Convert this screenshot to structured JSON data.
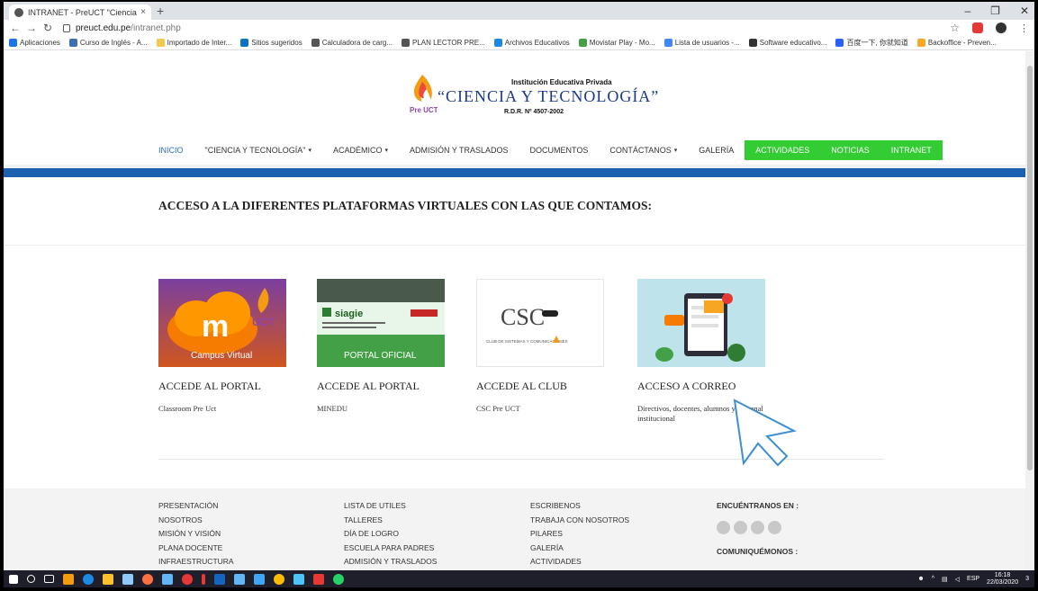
{
  "browser": {
    "tab_title": "INTRANET - PreUCT \"Ciencia y T",
    "tab_close": "×",
    "newtab": "+",
    "url_host": "preuct.edu.pe",
    "url_path": "/intranet.php",
    "bookmarks": [
      {
        "label": "Aplicaciones",
        "color": "#1a73e8"
      },
      {
        "label": "Curso de Inglés - A...",
        "color": "#3e6fb5"
      },
      {
        "label": "Importado de Inter...",
        "color": "#f2c94c"
      },
      {
        "label": "Sitios sugeridos",
        "color": "#0b73c2"
      },
      {
        "label": "Calculadora de carg...",
        "color": "#555555"
      },
      {
        "label": "PLAN LECTOR PRE...",
        "color": "#555555"
      },
      {
        "label": "Archivos Educativos",
        "color": "#1e88e5"
      },
      {
        "label": "Movistar Play - Mo...",
        "color": "#43a047"
      },
      {
        "label": "Lista de usuarios -...",
        "color": "#4285f4"
      },
      {
        "label": "Software educativo...",
        "color": "#333333"
      },
      {
        "label": "百度一下, 你就知道",
        "color": "#2962ff"
      },
      {
        "label": "Backoffice - Preven...",
        "color": "#f9a825"
      }
    ]
  },
  "site": {
    "logo_badge": "Pre UCT",
    "logo_sub": "Institución Educativa Privada",
    "logo_main": "“CIENCIA Y TECNOLOGÍA”",
    "logo_rdr": "R.D.R. Nº 4507-2002",
    "nav": [
      {
        "label": "INICIO",
        "style": "active",
        "caret": ""
      },
      {
        "label": "\"CIENCIA Y TECNOLOGÍA\"",
        "style": "",
        "caret": "▾"
      },
      {
        "label": "ACADÉMICO",
        "style": "",
        "caret": "▾"
      },
      {
        "label": "ADMISIÓN Y TRASLADOS",
        "style": "",
        "caret": ""
      },
      {
        "label": "DOCUMENTOS",
        "style": "",
        "caret": ""
      },
      {
        "label": "CONTÁCTANOS",
        "style": "",
        "caret": "▾"
      },
      {
        "label": "GALERÍA",
        "style": "",
        "caret": ""
      },
      {
        "label": "ACTIVIDADES",
        "style": "green",
        "caret": ""
      },
      {
        "label": "NOTICIAS",
        "style": "green",
        "caret": ""
      },
      {
        "label": "INTRANET",
        "style": "green",
        "caret": ""
      }
    ],
    "section_title": "ACCESO A LA DIFERENTES PLATAFORMAS VIRTUALES CON LAS QUE CONTAMOS:",
    "cards": [
      {
        "title": "ACCEDE AL PORTAL",
        "desc": "Classroom Pre Uct",
        "thumb_caption": "Campus Virtual"
      },
      {
        "title": "ACCEDE AL PORTAL",
        "desc": "MINEDU",
        "thumb_caption": "PORTAL OFICIAL",
        "thumb_brand": "siagie"
      },
      {
        "title": "ACCEDE AL CLUB",
        "desc": "CSC Pre UCT",
        "thumb_caption": "CLUB DE SISTEMAS Y COMUNICACIONES",
        "thumb_brand": "CSC"
      },
      {
        "title": "ACCESO A CORREO",
        "desc": "Directivos, docentes, alumnos y personal institucional"
      }
    ],
    "footer": {
      "col1": [
        "PRESENTACIÓN",
        "NOSOTROS",
        "MISIÓN Y VISIÓN",
        "PLANA DOCENTE",
        "INFRAESTRUCTURA"
      ],
      "col2": [
        "LISTA DE UTILES",
        "TALLERES",
        "DÍA DE LOGRO",
        "ESCUELA PARA PADRES",
        "ADMISIÓN Y TRASLADOS"
      ],
      "col3": [
        "ESCRIBENOS",
        "TRABAJA CON NOSOTROS",
        "PILARES",
        "GALERÍA",
        "ACTIVIDADES"
      ],
      "find_us": "ENCUÉNTRANOS EN :",
      "contact": "COMUNIQUÉMONOS :"
    }
  },
  "taskbar": {
    "lang": "ESP",
    "time": "16:18",
    "date": "22/03/2020",
    "notif": "3"
  }
}
